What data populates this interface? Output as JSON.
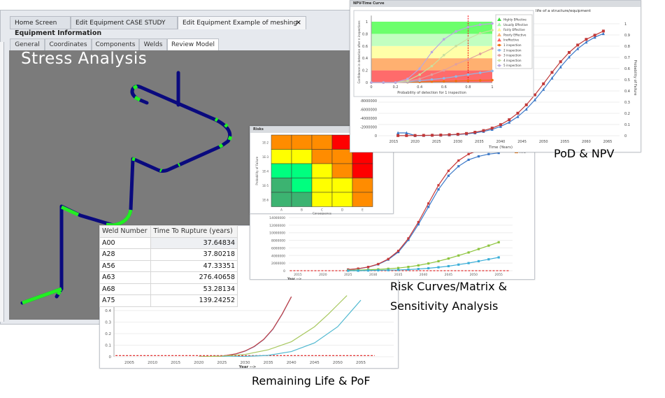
{
  "app": {
    "tabs": [
      {
        "label": "Home Screen",
        "active": false
      },
      {
        "label": "Edit Equipment CASE STUDY",
        "active": false
      },
      {
        "label": "Edit Equipment Example of meshing",
        "active": true
      }
    ],
    "close_icon": "×",
    "section_title": "Equipment Information",
    "subtabs": [
      {
        "label": "General",
        "active": false
      },
      {
        "label": "Coordinates",
        "active": false
      },
      {
        "label": "Components",
        "active": false
      },
      {
        "label": "Welds",
        "active": false
      },
      {
        "label": "Review Model",
        "active": true
      }
    ],
    "pipe_color": "#0a0a7e",
    "weld_color": "#22ee22"
  },
  "captions": {
    "stress": "Stress Analysis",
    "pod_npv": "PoD & NPV",
    "risk_line1": "Risk Curves/Matrix &",
    "risk_line2": "Sensitivity Analysis",
    "remaining": "Remaining Life & PoF"
  },
  "weld_table": {
    "headers": [
      "Weld Number",
      "Time To Rupture (years)"
    ],
    "rows": [
      [
        "A00",
        "37.64834"
      ],
      [
        "A28",
        "37.80218"
      ],
      [
        "A56",
        "47.33351"
      ],
      [
        "A63",
        "276.40658"
      ],
      [
        "A68",
        "53.28134"
      ],
      [
        "A75",
        "139.24252"
      ]
    ]
  },
  "npv_panel": {
    "title": "NPV-Time Curve",
    "subtitle": "life of a structure/equipment"
  },
  "risk_panel": {
    "title": "Risks"
  },
  "chart_data": [
    {
      "id": "pod",
      "type": "line",
      "xlabel": "Probability of detection for 1 inspection",
      "ylabel": "Confidence in detection after n inspections",
      "xlim": [
        0,
        1
      ],
      "ylim": [
        0,
        1
      ],
      "xticks": [
        0,
        0.2,
        0.4,
        0.6,
        0.8,
        1
      ],
      "yticks": [
        0,
        0.2,
        0.4,
        0.6,
        0.8,
        1
      ],
      "bands": [
        {
          "name": "Ineffective",
          "from": 0,
          "to": 0.2,
          "color": "#ff6b6b"
        },
        {
          "name": "Poorly Effective",
          "from": 0.2,
          "to": 0.4,
          "color": "#ffb070"
        },
        {
          "name": "Fairly Effective",
          "from": 0.4,
          "to": 0.6,
          "color": "#ffffa8"
        },
        {
          "name": "Usually Effective",
          "from": 0.6,
          "to": 0.8,
          "color": "#c2ffc0"
        },
        {
          "name": "Highly Effective",
          "from": 0.8,
          "to": 1,
          "color": "#6cff6c"
        }
      ],
      "band_legend_order": [
        "Highly Effective",
        "Usually Effective",
        "Fairly Effective",
        "Poorly Effective",
        "Ineffective"
      ],
      "band_legend_colors": [
        "#3ddc3d",
        "#a8f5a8",
        "#fff59a",
        "#ffb070",
        "#ff6060"
      ],
      "vline": 0.8,
      "x": [
        0,
        0.1,
        0.2,
        0.3,
        0.4,
        0.5,
        0.6,
        0.7,
        0.8,
        0.9,
        1
      ],
      "series": [
        {
          "name": "1 inspection",
          "color": "#f07010",
          "values": [
            0,
            0,
            0,
            0.005,
            0.01,
            0.015,
            0.02,
            0.025,
            0.03,
            0.035,
            0.04
          ]
        },
        {
          "name": "2 inspection",
          "color": "#8fb8e8",
          "values": [
            0,
            0,
            0,
            0.01,
            0.03,
            0.05,
            0.07,
            0.1,
            0.13,
            0.16,
            0.19
          ]
        },
        {
          "name": "3 inspection",
          "color": "#e0a0a0",
          "values": [
            0,
            0,
            0,
            0.02,
            0.06,
            0.13,
            0.2,
            0.3,
            0.38,
            0.47,
            0.56
          ]
        },
        {
          "name": "4 inspection",
          "color": "#c8e0a0",
          "values": [
            0,
            0,
            0,
            0.03,
            0.13,
            0.27,
            0.45,
            0.6,
            0.72,
            0.81,
            0.86
          ]
        },
        {
          "name": "5 inspection",
          "color": "#b8a8e0",
          "values": [
            0,
            0,
            0,
            0.06,
            0.23,
            0.5,
            0.71,
            0.84,
            0.91,
            0.95,
            0.97
          ]
        }
      ]
    },
    {
      "id": "npv",
      "type": "line",
      "xlabel": "Time (Years)",
      "ylabel_right": "Probability of Failure",
      "xticks": [
        2015,
        2020,
        2025,
        2030,
        2035,
        2040,
        2045,
        2050,
        2055,
        2060,
        2065
      ],
      "yticks_left": [
        "0",
        "-2000000",
        "-4000000",
        "-6000000",
        "-8000000"
      ],
      "yticks_right": [
        0,
        0.1,
        0.2,
        0.3,
        0.4,
        0.5,
        0.6,
        0.7,
        0.8,
        0.9,
        1
      ],
      "ylim_right": [
        0,
        1
      ],
      "x": [
        2016,
        2018,
        2020,
        2022,
        2024,
        2026,
        2028,
        2030,
        2032,
        2034,
        2036,
        2038,
        2040,
        2042,
        2044,
        2046,
        2048,
        2050,
        2052,
        2054,
        2056,
        2058,
        2060,
        2062,
        2064
      ],
      "series": [
        {
          "color": "#3a78c8",
          "marker": "triangle",
          "values": [
            0.025,
            0.025,
            0.001,
            0.002,
            0.003,
            0.005,
            0.007,
            0.011,
            0.016,
            0.025,
            0.038,
            0.056,
            0.083,
            0.12,
            0.17,
            0.237,
            0.32,
            0.414,
            0.515,
            0.614,
            0.703,
            0.777,
            0.836,
            0.88,
            0.912
          ]
        },
        {
          "color": "#c03838",
          "marker": "square",
          "values": [
            0.001,
            0.001,
            0.002,
            0.003,
            0.004,
            0.006,
            0.009,
            0.013,
            0.02,
            0.031,
            0.046,
            0.068,
            0.099,
            0.143,
            0.201,
            0.276,
            0.365,
            0.464,
            0.566,
            0.661,
            0.744,
            0.81,
            0.861,
            0.898,
            0.935
          ]
        }
      ]
    },
    {
      "id": "risk_matrix",
      "type": "heatmap",
      "xlabel": "Consequence",
      "ylabel": "Probability of Failure",
      "columns": [
        "A",
        "B",
        "C",
        "D",
        "E"
      ],
      "rows": [
        "1E-2",
        "1E-3",
        "1E-4",
        "1E-5",
        "1E-6"
      ],
      "colors": [
        [
          "#ff8c00",
          "#ff8c00",
          "#ff8c00",
          "#ff0000",
          "#ff0000"
        ],
        [
          "#ffff00",
          "#ffff00",
          "#ff8c00",
          "#ff8c00",
          "#ff0000"
        ],
        [
          "#00ff7f",
          "#00ff7f",
          "#ffff00",
          "#ff8c00",
          "#ff0000"
        ],
        [
          "#3cb371",
          "#00ff7f",
          "#ffff00",
          "#ffff00",
          "#ff8c00"
        ],
        [
          "#3cb371",
          "#3cb371",
          "#ffff00",
          "#ffff00",
          "#ff8c00"
        ]
      ]
    },
    {
      "id": "risk_curves",
      "type": "line",
      "xlabel": "Year -->",
      "xticks": [
        2015,
        2020,
        2025,
        2030,
        2035,
        2040,
        2045,
        2050,
        2055
      ],
      "yticks": [
        0,
        2000000,
        4000000,
        6000000,
        8000000,
        10000000,
        12000000,
        14000000
      ],
      "legend": [
        "A75"
      ],
      "x": [
        2025,
        2027,
        2029,
        2031,
        2033,
        2035,
        2037,
        2039,
        2041,
        2043,
        2045,
        2047,
        2049,
        2051,
        2053,
        2055
      ],
      "series": [
        {
          "color": "#3a78c8",
          "values": [
            280000,
            510000,
            930000,
            1670000,
            2930000,
            4900000,
            8100000,
            12200000,
            16800000,
            21400000,
            25000000,
            27500000,
            29200000,
            30100000,
            30700000,
            31000000
          ]
        },
        {
          "color": "#c83838",
          "values": [
            300000,
            540000,
            980000,
            1760000,
            3080000,
            5200000,
            8500000,
            12800000,
            17700000,
            22500000,
            26300000,
            29000000,
            30700000,
            31700000,
            32300000,
            32600000
          ]
        },
        {
          "color": "#8cc43c",
          "values": [
            100000,
            150000,
            250000,
            350000,
            500000,
            700000,
            1000000,
            1400000,
            1900000,
            2500000,
            3200000,
            4000000,
            4800000,
            5700000,
            6600000,
            7500000
          ]
        },
        {
          "color": "#3aaed8",
          "values": [
            0,
            0,
            50000,
            100000,
            150000,
            200000,
            300000,
            450000,
            650000,
            900000,
            1200000,
            1600000,
            2000000,
            2500000,
            3000000,
            3500000
          ]
        }
      ],
      "threshold": {
        "value": 0,
        "color": "#e03030",
        "style": "dashed"
      }
    },
    {
      "id": "remaining_life",
      "type": "line",
      "xlabel": "Year -->",
      "xticks": [
        2005,
        2010,
        2015,
        2020,
        2025,
        2030,
        2035,
        2040,
        2045,
        2050,
        2055
      ],
      "yticks": [
        0,
        0.1,
        0.2,
        0.3,
        0.4
      ],
      "series": [
        {
          "color": "#3a6ac8",
          "x": [
            2020,
            2025,
            2028,
            2030,
            2032,
            2034,
            2036,
            2038,
            2040
          ],
          "values": [
            0,
            0.005,
            0.024,
            0.049,
            0.088,
            0.148,
            0.238,
            0.368,
            0.52
          ]
        },
        {
          "color": "#c84040",
          "x": [
            2020,
            2025,
            2028,
            2030,
            2032,
            2034,
            2036,
            2038,
            2040
          ],
          "values": [
            0,
            0.005,
            0.025,
            0.05,
            0.09,
            0.15,
            0.24,
            0.37,
            0.52
          ]
        },
        {
          "color": "#a8c860",
          "x": [
            2020,
            2025,
            2030,
            2035,
            2040,
            2045,
            2048,
            2050,
            2052
          ],
          "values": [
            0,
            0.005,
            0.02,
            0.06,
            0.13,
            0.26,
            0.37,
            0.45,
            0.53
          ]
        },
        {
          "color": "#50b8d0",
          "x": [
            2025,
            2030,
            2035,
            2040,
            2045,
            2050,
            2055
          ],
          "values": [
            0,
            0.003,
            0.012,
            0.045,
            0.12,
            0.26,
            0.49
          ]
        }
      ],
      "threshold": {
        "value": 0.01,
        "color": "#e03030",
        "style": "dashed"
      }
    }
  ]
}
